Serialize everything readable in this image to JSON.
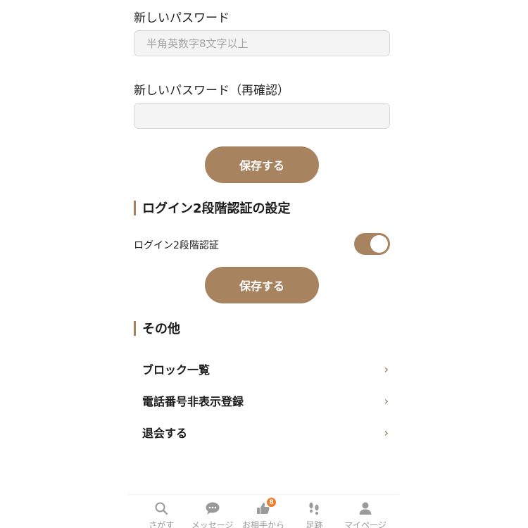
{
  "password": {
    "new_label": "新しいパスワード",
    "new_placeholder": "半角英数字8文字以上",
    "new_value": "",
    "confirm_label": "新しいパスワード（再確認）",
    "confirm_placeholder": "",
    "confirm_value": "",
    "save_label": "保存する"
  },
  "two_factor": {
    "section_title": "ログイン2段階認証の設定",
    "toggle_label": "ログイン2段階認証",
    "toggle_on": true,
    "save_label": "保存する"
  },
  "others": {
    "section_title": "その他",
    "items": [
      {
        "label": "ブロック一覧",
        "chevron": "›"
      },
      {
        "label": "電話番号非表示登録",
        "chevron": "›"
      },
      {
        "label": "退会する",
        "chevron": "›"
      }
    ]
  },
  "tabbar": {
    "items": [
      {
        "label": "さがす",
        "icon": "search-icon"
      },
      {
        "label": "メッセージ",
        "icon": "message-icon"
      },
      {
        "label": "お相手から",
        "icon": "thumbs-up-icon",
        "badge": "8"
      },
      {
        "label": "足跡",
        "icon": "footprints-icon"
      },
      {
        "label": "マイページ",
        "icon": "user-icon"
      }
    ]
  },
  "colors": {
    "accent": "#a7835f",
    "badge": "#f07c2a",
    "input_bg": "#f4f4f4",
    "tab_inactive": "#9a9a9a"
  }
}
